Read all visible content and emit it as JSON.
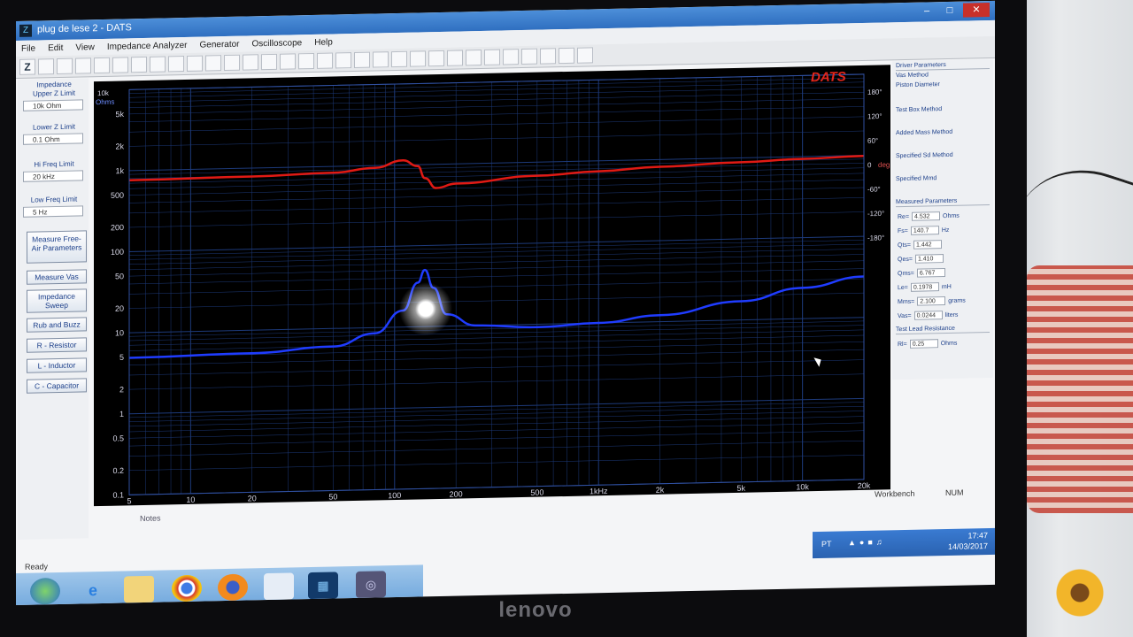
{
  "window": {
    "title": "plug de lese 2 - DATS",
    "app_icon": "dats-logo-icon"
  },
  "menu": [
    "File",
    "Edit",
    "View",
    "Impedance Analyzer",
    "Generator",
    "Oscilloscope",
    "Help"
  ],
  "toolbar": {
    "z_button": "Z"
  },
  "left_panel": {
    "impedance_title": "Impedance",
    "upper_label": "Upper Z Limit",
    "upper_value": "10k Ohm",
    "lower_label": "Lower Z Limit",
    "lower_value": "0.1 Ohm",
    "hi_label": "Hi Freq Limit",
    "hi_value": "20 kHz",
    "low_label": "Low Freq Limit",
    "low_value": "5 Hz",
    "buttons": [
      "Measure Free-Air Parameters",
      "Measure Vas",
      "Impedance Sweep",
      "Rub and Buzz",
      "R - Resistor",
      "L - Inductor",
      "C - Capacitor"
    ]
  },
  "right_panel": {
    "driver_params": "Driver Parameters",
    "vas_method": "Vas Method",
    "piston_diameter": "Piston Diameter",
    "test_enclosure": "Test Box Method",
    "added_mass": "Added Mass Method",
    "specified_sd": "Specified Sd Method",
    "specified_mmd": "Specified Mmd",
    "measured_params": "Measured Parameters",
    "params": [
      {
        "name": "Re=",
        "value": "4.532",
        "unit": "Ohms"
      },
      {
        "name": "Fs=",
        "value": "140.7",
        "unit": "Hz"
      },
      {
        "name": "Qts=",
        "value": "1.442",
        "unit": ""
      },
      {
        "name": "Qes=",
        "value": "1.410",
        "unit": ""
      },
      {
        "name": "Qms=",
        "value": "6.767",
        "unit": ""
      },
      {
        "name": "Le=",
        "value": "0.1978",
        "unit": "mH"
      },
      {
        "name": "Mms=",
        "value": "2.100",
        "unit": "grams"
      },
      {
        "name": "Vas=",
        "value": "0.0244",
        "unit": "liters"
      }
    ],
    "lead_resistance": "Test Lead Resistance",
    "rlead": {
      "name": "Rl=",
      "value": "0.25",
      "unit": "Ohms"
    }
  },
  "graph": {
    "brand": "DATS",
    "y_unit_top": "10k",
    "y_unit_label": "Ohms",
    "y_ticks": [
      "5k",
      "2k",
      "1k",
      "500",
      "200",
      "100",
      "50",
      "20",
      "10",
      "5",
      "2",
      "1",
      "0.5",
      "0.2",
      "0.1"
    ],
    "x_ticks": [
      "5",
      "10",
      "20",
      "50",
      "100",
      "200",
      "500",
      "1kHz",
      "2k",
      "5k",
      "10k",
      "20k"
    ],
    "phase_ticks": [
      "180°",
      "120°",
      "60°",
      "0",
      "-60°",
      "-120°",
      "-180°"
    ],
    "phase_unit": "deg"
  },
  "chart_data": {
    "type": "line",
    "xlabel": "",
    "ylabel": "Ohms",
    "x_scale": "log",
    "y_scale": "log",
    "xlim": [
      5,
      20000
    ],
    "ylim": [
      0.1,
      10000
    ],
    "grid": true,
    "series": [
      {
        "color": "#1f3cff",
        "x": [
          5,
          20,
          50,
          80,
          110,
          130,
          140.7,
          155,
          180,
          250,
          500,
          1000,
          2000,
          5000,
          10000,
          20000
        ],
        "y": [
          4.9,
          5.2,
          6,
          8.5,
          16,
          35,
          50,
          30,
          14,
          10,
          9.2,
          10,
          12,
          17,
          24,
          32
        ]
      },
      {
        "color": "#e01a14",
        "x": [
          5,
          20,
          50,
          80,
          110,
          130,
          140.7,
          160,
          200,
          500,
          1000,
          2000,
          5000,
          10000,
          20000
        ],
        "phase_deg": [
          0,
          3,
          8,
          18,
          35,
          20,
          -10,
          -35,
          -25,
          -10,
          -2,
          6,
          13,
          18,
          22
        ]
      }
    ]
  },
  "notes_label": "Notes",
  "status": {
    "ready": "Ready",
    "workbench": "Workbench",
    "num": "NUM"
  },
  "tray": {
    "lang": "PT",
    "time": "17:47",
    "date": "14/03/2017"
  },
  "monitor_brand": "lenovo"
}
